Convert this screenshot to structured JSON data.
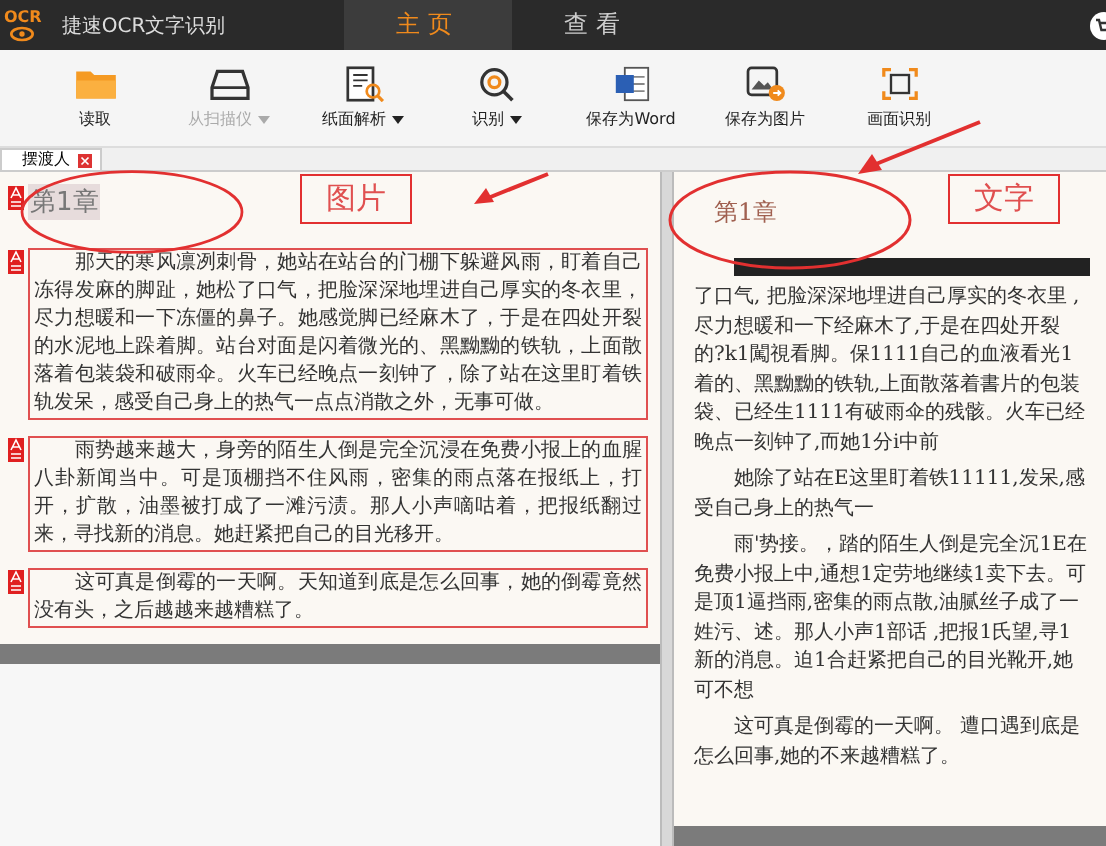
{
  "app": {
    "logo_text": "OCR",
    "title": "捷速OCR文字识别"
  },
  "nav_tabs": [
    {
      "label": "主页",
      "selected": true
    },
    {
      "label": "查看",
      "selected": false
    }
  ],
  "toolbar": [
    {
      "label": "读取",
      "kind": "folder",
      "disabled": false,
      "dropdown": false
    },
    {
      "label": "从扫描仪",
      "kind": "scanner",
      "disabled": true,
      "dropdown": true
    },
    {
      "label": "纸面解析",
      "kind": "analyze",
      "disabled": false,
      "dropdown": true
    },
    {
      "label": "识别",
      "kind": "recognize",
      "disabled": false,
      "dropdown": true
    },
    {
      "label": "保存为Word",
      "kind": "word",
      "disabled": false,
      "dropdown": false
    },
    {
      "label": "保存为图片",
      "kind": "image",
      "disabled": false,
      "dropdown": false
    },
    {
      "label": "画面识别",
      "kind": "frame",
      "disabled": false,
      "dropdown": false
    }
  ],
  "document_tabs": [
    {
      "label": "摆渡人"
    }
  ],
  "image_page": {
    "heading": "第1章",
    "blocks": [
      "　　那天的寒风凛冽刺骨，她站在站台的门棚下躲避风雨，盯着自己冻得发麻的脚趾，她松了口气，把脸深深地埋进自己厚实的冬衣里，尽力想暖和一下冻僵的鼻子。她感觉脚已经麻木了，于是在四处开裂的水泥地上跺着脚。站台对面是闪着微光的、黑黝黝的铁轨，上面散落着包装袋和破雨伞。火车已经晚点一刻钟了，除了站在这里盯着铁轨发呆，感受自己身上的热气一点点消散之外，无事可做。",
      "　　雨势越来越大，身旁的陌生人倒是完全沉浸在免费小报上的血腥八卦新闻当中。可是顶棚挡不住风雨，密集的雨点落在报纸上，打开，扩散，油墨被打成了一滩污渍。那人小声嘀咕着，把报纸翻过来，寻找新的消息。她赶紧把自己的目光移开。",
      "　　这可真是倒霉的一天啊。天知道到底是怎么回事，她的倒霉竟然没有头，之后越越来越糟糕了。"
    ]
  },
  "text_page": {
    "heading": "第1章",
    "paragraphs": [
      "了口气, 把脸深深地埋进自己厚实的冬衣里 ,尽力想暖和一下经麻木了,于是在四处开裂的?k1闖視看脚。保1111自己的血液看光1着的、黑黝黝的铁轨,上面散落着書片的包装袋、已经生1111有破雨伞的残骸。火车已经晚点一刻钟了,而她1分i中前",
      "　　她除了站在E这里盯着铁11111,发呆,感受自己身上的热气一",
      "　　雨'势接。，踏的陌生人倒是完全沉1E在免费小报上中,通想1定劳地继续1卖下去。可是顶1逼挡雨,密集的雨点散,油腻丝子成了一姓污、述。那人小声1部话 ,把报1氏望,寻1新的消息。迫1合赶紧把自己的目光靴开,她可不想",
      "　　这可真是倒霉的一天啊。 遭口遇到底是怎么回事,她的不来越糟糕了。"
    ]
  },
  "annotations": [
    {
      "label": "图片"
    },
    {
      "label": "文字"
    }
  ]
}
